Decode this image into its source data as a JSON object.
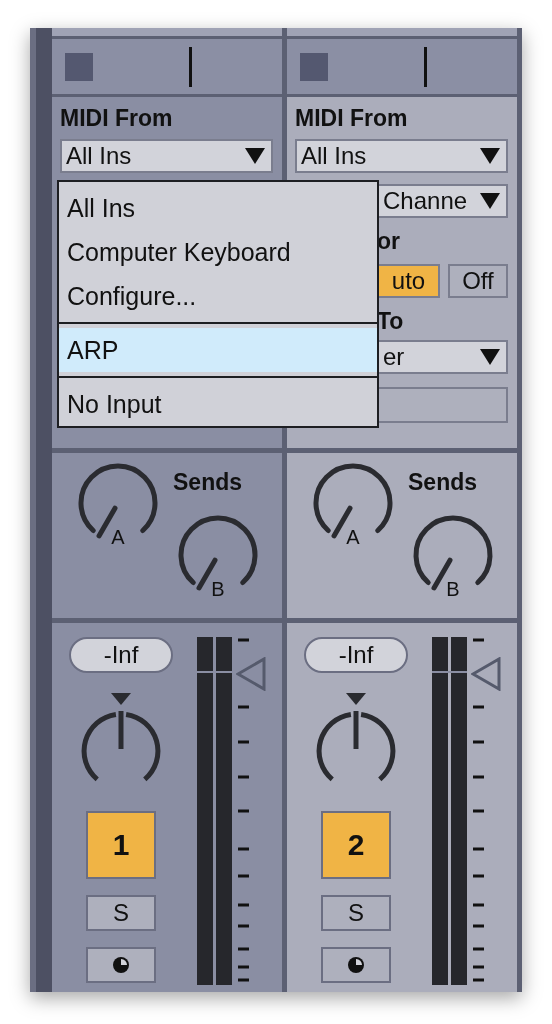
{
  "tracks": [
    {
      "selected": false,
      "io": {
        "label": "MIDI From",
        "source": "All Ins"
      },
      "sends": {
        "title": "Sends",
        "knobs": [
          "A",
          "B"
        ]
      },
      "mixer": {
        "volume": "-Inf",
        "activator": {
          "label": "1",
          "on": true
        },
        "solo": {
          "label": "S",
          "on": false
        }
      }
    },
    {
      "selected": true,
      "io": {
        "label": "MIDI From",
        "source": "All Ins",
        "channel": "Channe",
        "monitor_label": "or",
        "monitor": [
          {
            "label": "uto",
            "selected": true
          },
          {
            "label": "Off",
            "selected": false
          }
        ],
        "output_label": "To",
        "output": "er"
      },
      "sends": {
        "title": "Sends",
        "knobs": [
          "A",
          "B"
        ]
      },
      "mixer": {
        "volume": "-Inf",
        "activator": {
          "label": "2",
          "on": true
        },
        "solo": {
          "label": "S",
          "on": false
        }
      }
    }
  ],
  "menu": {
    "sections": [
      {
        "items": [
          {
            "label": "All Ins",
            "selected": false
          },
          {
            "label": "Computer Keyboard",
            "selected": false
          },
          {
            "label": "Configure...",
            "selected": false
          }
        ]
      },
      {
        "items": [
          {
            "label": "ARP",
            "selected": true
          }
        ]
      },
      {
        "items": [
          {
            "label": "No Input",
            "selected": false
          }
        ]
      }
    ]
  }
}
